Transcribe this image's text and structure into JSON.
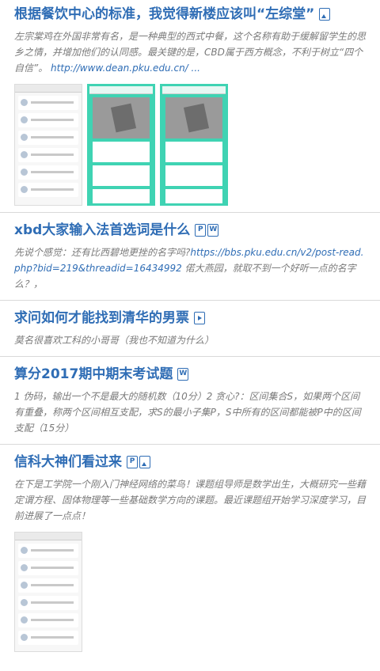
{
  "posts": [
    {
      "title": "根据餐饮中心的标准，我觉得新楼应该叫“左综堂”",
      "icons": [
        "image-icon"
      ],
      "excerpt": "左宗棠鸡在外国非常有名，是一种典型的西式中餐，这个名称有助于缓解留学生的思乡之情，并增加他们的认同感。最关键的是，CBD属于西方概念，不利于树立“四个自信”。",
      "link_text": "http://www.dean.pku.edu.cn/ ..."
    },
    {
      "title": "xbd大家输入法首选词是什么",
      "icons": [
        "pdf-icon",
        "word-icon"
      ],
      "excerpt": "先说个感觉：还有比西碧地更挫的名字吗?",
      "link_text": "https://bbs.pku.edu.cn/v2/post-read.php?bid=219&threadid=16434992",
      "excerpt_tail": " 偌大燕园，就取不到一个好听一点的名字么？，"
    },
    {
      "title": "求问如何才能找到清华的男票",
      "icons": [
        "video-icon"
      ],
      "excerpt": "莫名很喜欢工科的小哥哥（我也不知道为什么）"
    },
    {
      "title": "算分2017期中期末考试题",
      "icons": [
        "word-icon"
      ],
      "excerpt": "1 伪码，输出一个不是最大的随机数（10分）2 贪心?：区间集合S，如果两个区间有重叠，称两个区间相互支配，求S的最小子集P，S中所有的区间都能被P中的区间支配（15分）"
    },
    {
      "title": "信科大神们看过来",
      "icons": [
        "pdf-icon",
        "image-icon"
      ],
      "excerpt": "在下是工学院一个刚入门神经网络的菜鸟！课题组导师是数学出生，大概研究一些藉定谓方程、固体物理等一些基础数学方向的课题。最近课题组开始学习深度学习，目前进展了一点点！"
    }
  ],
  "icon_glyphs": {
    "pdf-icon": "P",
    "word-icon": "W"
  },
  "colors": {
    "title": "#2f6db5",
    "excerpt": "#7a7a7a",
    "thumb_accent": "#3fd3b3"
  }
}
